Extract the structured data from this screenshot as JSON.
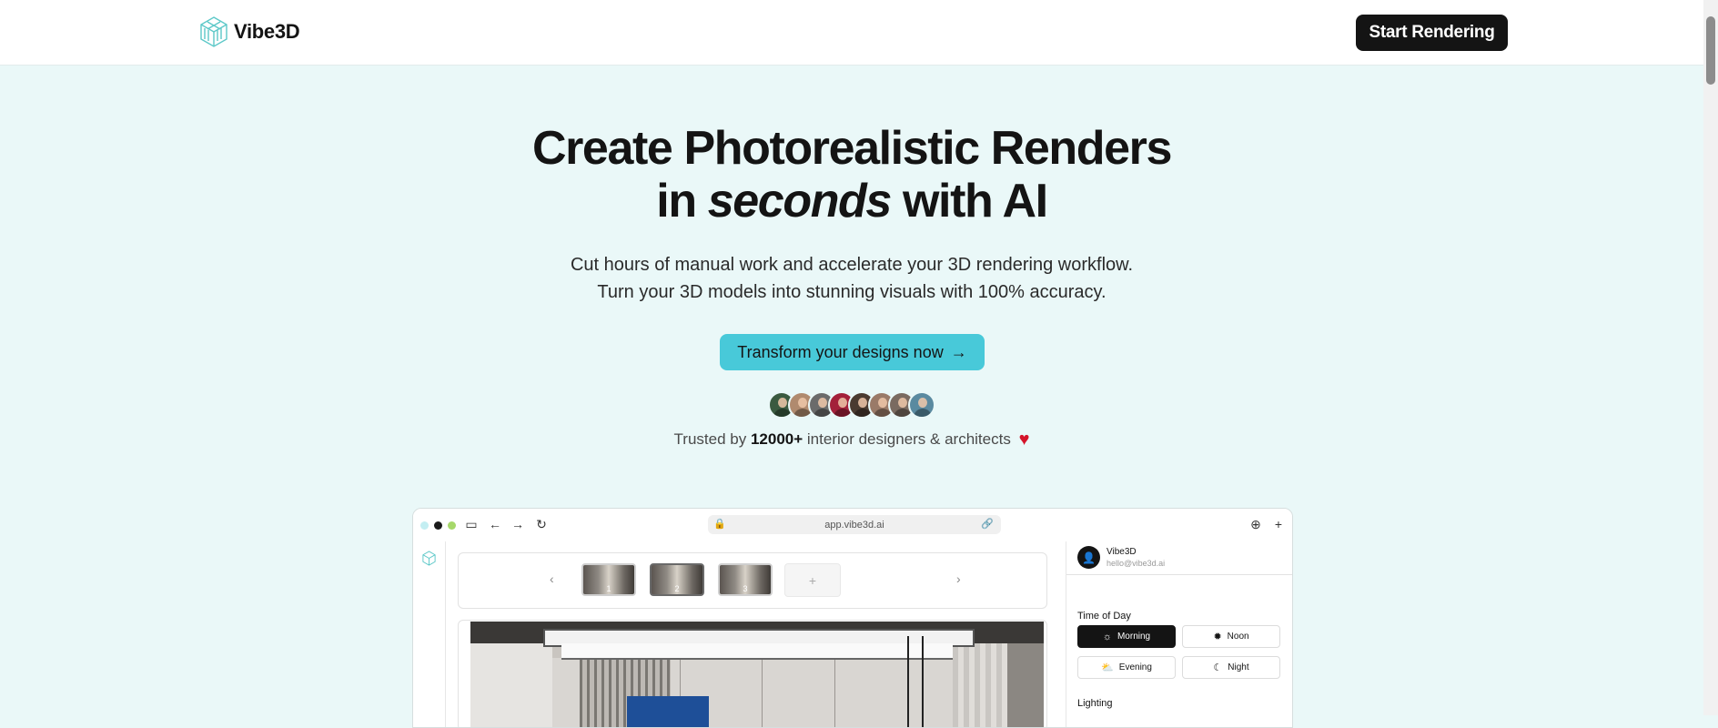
{
  "header": {
    "brand": "Vibe3D",
    "start_button": "Start Rendering"
  },
  "hero": {
    "title_line1": "Create Photorealistic Renders",
    "title_in": "in",
    "title_emphasis": "seconds",
    "title_end": "with AI",
    "subtitle_line1": "Cut hours of manual work and accelerate your 3D rendering workflow.",
    "subtitle_line2": "Turn your 3D models into stunning visuals with 100% accuracy.",
    "cta": "Transform your designs now",
    "cta_icon": "arrow-right-icon",
    "avatar_count": 8,
    "trusted_prefix": "Trusted by",
    "trusted_count": "12000+",
    "trusted_suffix": "interior designers & architects",
    "heart": "♥"
  },
  "mockup": {
    "url": "app.vibe3d.ai",
    "thumbnails": [
      "1",
      "2",
      "3"
    ],
    "selected_thumbnail": "2",
    "add_label": "+",
    "user": {
      "name": "Vibe3D",
      "email": "hello@vibe3d.ai"
    },
    "time_of_day": {
      "label": "Time of Day",
      "options": [
        "Morning",
        "Noon",
        "Evening",
        "Night"
      ],
      "selected": "Morning"
    },
    "lighting_label": "Lighting"
  },
  "colors": {
    "page_bg": "#eaf8f8",
    "primary_dark": "#141414",
    "accent": "#48c9d9",
    "dot_teal": "#c3eef2",
    "dot_black": "#1a1a1a",
    "dot_green": "#a6d86a"
  }
}
